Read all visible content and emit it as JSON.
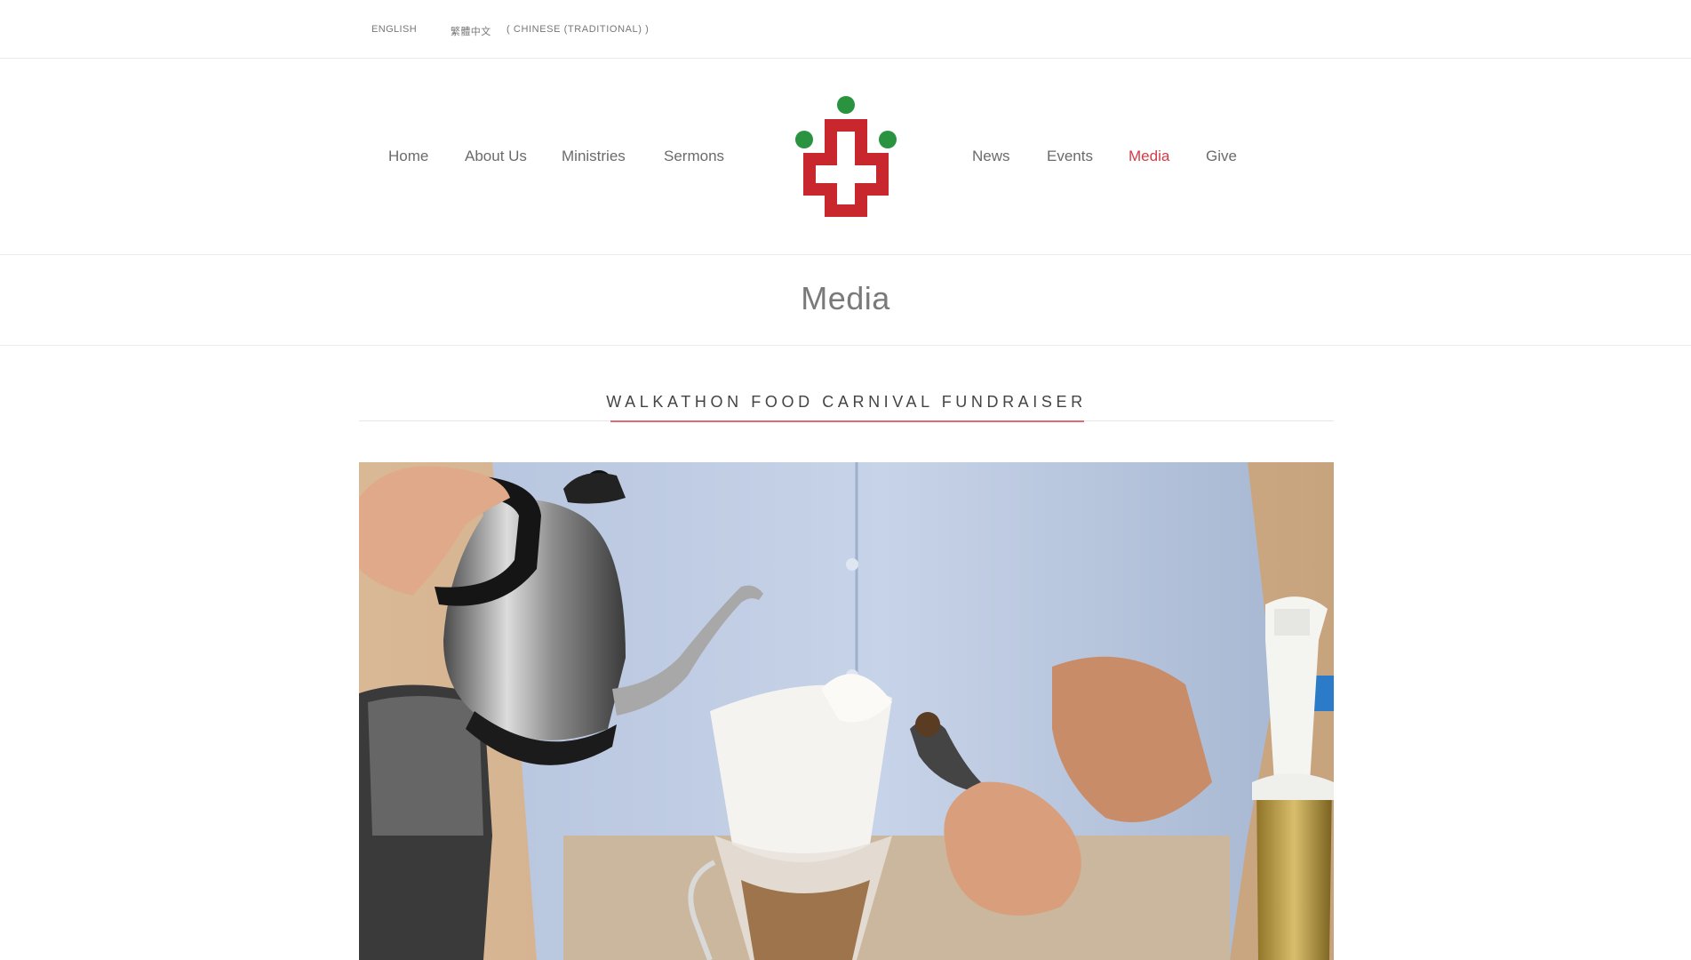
{
  "language_bar": {
    "english": "ENGLISH",
    "chinese": "繁體中文",
    "chinese_note": "( CHINESE (TRADITIONAL) )"
  },
  "nav": {
    "left": [
      "Home",
      "About Us",
      "Ministries",
      "Sermons"
    ],
    "right": [
      "News",
      "Events",
      "Media",
      "Give"
    ],
    "active": "Media"
  },
  "page_title": "Media",
  "post": {
    "title": "WALKATHON FOOD CARNIVAL FUNDRAISER"
  },
  "colors": {
    "accent": "#d43b47",
    "logo_red": "#c8282d",
    "logo_green": "#2a9340"
  }
}
